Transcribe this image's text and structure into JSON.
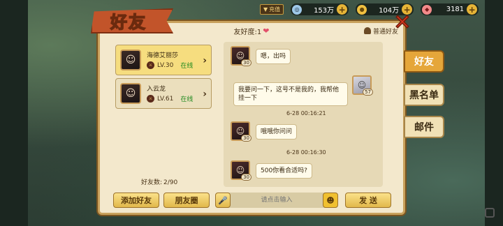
{
  "topbar": {
    "recharge_label": "充值",
    "currencies": [
      {
        "icon": "silver-coin-icon",
        "value": "153万"
      },
      {
        "icon": "gold-coin-icon",
        "value": "104万"
      },
      {
        "icon": "gem-icon",
        "value": "3181"
      }
    ]
  },
  "panel": {
    "title": "好友",
    "favorability_label": "友好度:1",
    "friend_type": "普通好友"
  },
  "friends": [
    {
      "name": "海德艾丽莎",
      "level": "LV.30",
      "status": "在线"
    },
    {
      "name": "入云龙",
      "level": "LV.61",
      "status": "在线"
    }
  ],
  "friend_count": {
    "label": "好友数:",
    "value": "2/90"
  },
  "chat": {
    "messages": [
      {
        "from": "other",
        "level": "30",
        "text": "嗯，出吗"
      },
      {
        "from": "self",
        "level": "57",
        "text": "我要问一下，这号不是我的，我帮他挂一下"
      },
      {
        "timestamp": "6-28 00:16:21"
      },
      {
        "from": "other",
        "level": "30",
        "text": "哦哦你问问"
      },
      {
        "timestamp": "6-28 00:16:30"
      },
      {
        "from": "other",
        "level": "30",
        "text": "500你看合适吗?"
      }
    ],
    "input_placeholder": "请点击输入"
  },
  "buttons": {
    "add_friend": "添加好友",
    "moments": "朋友圈",
    "send": "发  送"
  },
  "tabs": [
    {
      "label": "好友",
      "active": true
    },
    {
      "label": "黑名单",
      "active": false
    },
    {
      "label": "邮件",
      "active": false
    }
  ],
  "colors": {
    "panel_bg": "#f3e8cc",
    "accent_gold": "#e1b84b",
    "online_green": "#1f8a1f",
    "title_red": "#c2542a"
  }
}
